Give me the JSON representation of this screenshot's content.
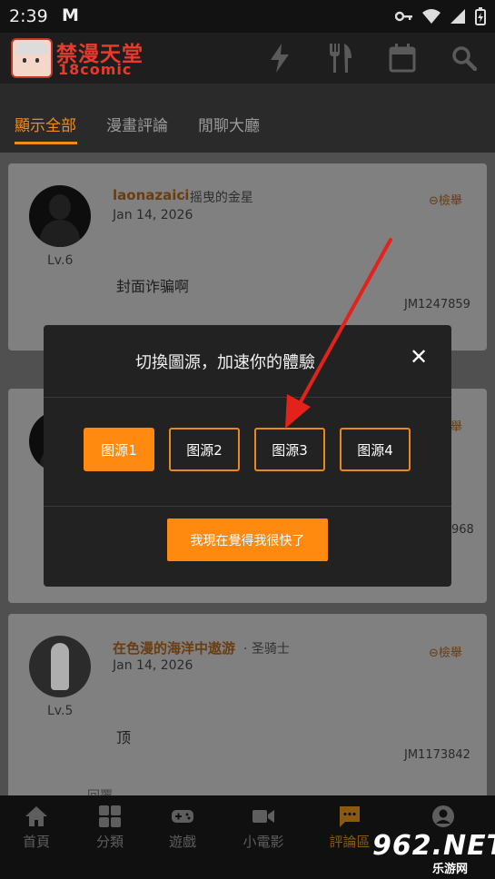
{
  "status_bar": {
    "time": "2:39",
    "mail_glyph": "M"
  },
  "app": {
    "logo_text": "禁漫天堂",
    "logo_sub": "18comic",
    "toolbar_icons": [
      "lightning-icon",
      "fork-knife-icon",
      "calendar-icon",
      "search-icon"
    ]
  },
  "tabs": [
    {
      "label": "顯示全部",
      "active": true
    },
    {
      "label": "漫畫評論",
      "active": false
    },
    {
      "label": "閒聊大廳",
      "active": false
    }
  ],
  "comments": [
    {
      "level": "Lv.6",
      "username": "laonazaici",
      "title": "· 摇曳的金星",
      "date": "Jan 14, 2026",
      "report": "檢舉",
      "text": "封面诈骗啊",
      "id": "JM1247859"
    },
    {
      "level": "",
      "username": "",
      "title": "",
      "date": "",
      "report": "檢舉",
      "text": "",
      "id": "968"
    },
    {
      "level": "Lv.5",
      "username": "在色漫的海洋中遨游",
      "title": "· 圣骑士",
      "date": "Jan 14, 2026",
      "report": "檢舉",
      "text": "顶",
      "id": "JM1173842",
      "reply": "回覆"
    }
  ],
  "dialog": {
    "title": "切換圖源，加速你的體驗",
    "close": "✕",
    "sources": [
      {
        "label": "图源1",
        "selected": true
      },
      {
        "label": "图源2",
        "selected": false
      },
      {
        "label": "图源3",
        "selected": false
      },
      {
        "label": "图源4",
        "selected": false
      }
    ],
    "confirm": "我現在覺得我很快了"
  },
  "bottom_nav": [
    {
      "label": "首頁",
      "icon": "home-icon"
    },
    {
      "label": "分類",
      "icon": "grid-icon"
    },
    {
      "label": "遊戲",
      "icon": "gamepad-icon"
    },
    {
      "label": "小電影",
      "icon": "video-icon"
    },
    {
      "label": "評論區",
      "icon": "chat-icon",
      "active": true
    },
    {
      "label": "",
      "icon": "profile-icon"
    }
  ],
  "watermark": {
    "big": "962.NET",
    "small": "乐游网"
  },
  "colors": {
    "accent": "#ff8a0f",
    "tab_active": "#f28b1e",
    "arrow": "#e3231b"
  }
}
